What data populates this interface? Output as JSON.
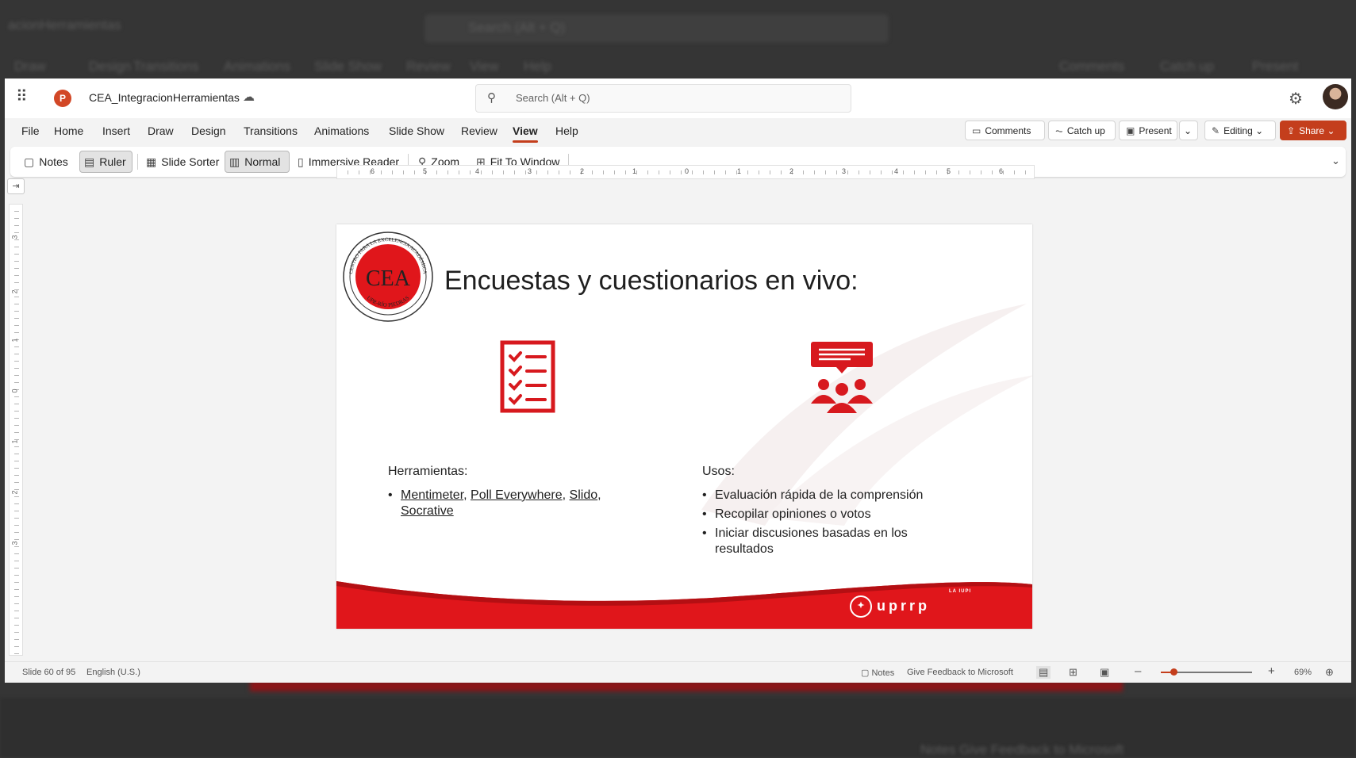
{
  "app": {
    "doc_name": "CEA_IntegracionHerramientas",
    "search_placeholder": "Search (Alt + Q)"
  },
  "background": {
    "title": "acionHerramientas",
    "search": "Search (Alt + Q)",
    "tabs": [
      "Draw",
      "Design",
      "Transitions",
      "Animations",
      "Slide Show",
      "Review",
      "View",
      "Help"
    ],
    "buttons": [
      "Comments",
      "Catch up",
      "Present"
    ],
    "status": "Notes  Give Feedback to Microsoft"
  },
  "menu": {
    "tabs": [
      "File",
      "Home",
      "Insert",
      "Draw",
      "Design",
      "Transitions",
      "Animations",
      "Slide Show",
      "Review",
      "View",
      "Help"
    ],
    "active_tab": "View",
    "comments": "Comments",
    "catch_up": "Catch up",
    "present": "Present",
    "editing": "Editing",
    "share": "Share"
  },
  "ribbon": {
    "notes": "Notes",
    "ruler": "Ruler",
    "slide_sorter": "Slide Sorter",
    "normal": "Normal",
    "immersive_reader": "Immersive Reader",
    "zoom": "Zoom",
    "fit_to_window": "Fit To Window"
  },
  "ruler": {
    "h_numbers": [
      "6",
      "5",
      "4",
      "3",
      "2",
      "1",
      "0",
      "1",
      "2",
      "3",
      "4",
      "5",
      "6"
    ],
    "v_numbers": [
      "3",
      "2",
      "1",
      "0",
      "1",
      "2",
      "3"
    ]
  },
  "slide": {
    "title": "Encuestas y cuestionarios en vivo:",
    "left_heading": "Herramientas:",
    "tools": [
      "Mentimeter",
      "Poll Everywhere",
      "Slido",
      "Socrative"
    ],
    "right_heading": "Usos:",
    "uses": [
      "Evaluación rápida de la comprensión",
      "Recopilar opiniones o votos",
      "Iniciar discusiones basadas en los resultados"
    ],
    "seal_letters": "CEA",
    "seal_ring": "CENTRO PARA LA EXCELENCIA ACADÉMICA",
    "seal_bottom": "UPR-RÍO PIEDRAS",
    "footer_logo": "uprrp",
    "footer_small": "LA IUPI",
    "brand_red": "#e0161b"
  },
  "status": {
    "slide_info": "Slide 60 of 95",
    "language": "English (U.S.)",
    "notes": "Notes",
    "feedback": "Give Feedback to Microsoft",
    "zoom": "69%"
  },
  "colors": {
    "accent": "#c43e1c",
    "slide_red": "#e0161b"
  }
}
